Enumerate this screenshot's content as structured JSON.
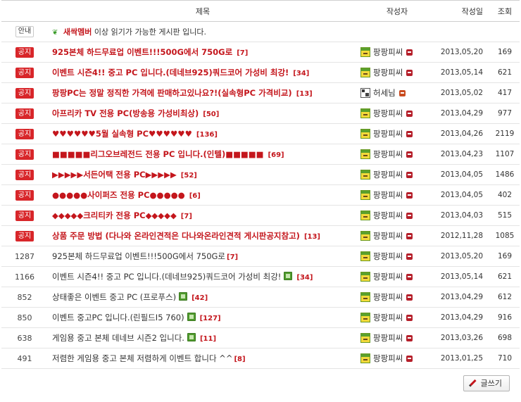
{
  "header": {
    "subject": "제목",
    "author": "작성자",
    "date": "작성일",
    "views": "조회"
  },
  "guide": {
    "badge": "안내",
    "strong": "새싹멤버",
    "rest": " 이상 읽기가 가능한 게시판 입니다."
  },
  "notice_badge": "공지",
  "notices": [
    {
      "title": "925본체 하드무료업 이벤트!!!500G에서 750G로",
      "comments": "[7]",
      "author": "팡팡피씨",
      "avatar": "green",
      "date": "2013,05,20",
      "views": "169"
    },
    {
      "title": "이벤트 시즌4!! 중고 PC 입니다.(데네브925)쿼드코어 가성비 최강!",
      "comments": "[34]",
      "author": "팡팡피씨",
      "avatar": "green",
      "date": "2013,05,14",
      "views": "621"
    },
    {
      "title": "팡팡PC는 정말 정직한 가격에 판매하고있나요?!(실속형PC 가격비교)",
      "comments": "[13]",
      "author": "허세님",
      "avatar": "gray",
      "date": "2013,05,02",
      "views": "417"
    },
    {
      "title": "아프리카 TV 전용 PC(방송용 가성비최상)",
      "comments": "[50]",
      "author": "팡팡피씨",
      "avatar": "green",
      "date": "2013,04,29",
      "views": "977"
    },
    {
      "title": "♥♥♥♥♥♥5월 실속형 PC♥♥♥♥♥♥",
      "comments": "[136]",
      "author": "팡팡피씨",
      "avatar": "green",
      "date": "2013,04,26",
      "views": "2119"
    },
    {
      "title": "■■■■■리그오브레전드 전용 PC 입니다.(인텔)■■■■■",
      "comments": "[69]",
      "author": "팡팡피씨",
      "avatar": "green",
      "date": "2013,04,23",
      "views": "1107"
    },
    {
      "title": "▶▶▶▶▶서든어택 전용 PC▶▶▶▶▶",
      "comments": "[52]",
      "author": "팡팡피씨",
      "avatar": "green",
      "date": "2013,04,05",
      "views": "1486"
    },
    {
      "title": "●●●●●사이퍼즈 전용 PC●●●●●",
      "comments": "[6]",
      "author": "팡팡피씨",
      "avatar": "green",
      "date": "2013,04,05",
      "views": "402"
    },
    {
      "title": "◆◆◆◆◆크리티카 전용 PC◆◆◆◆◆",
      "comments": "[7]",
      "author": "팡팡피씨",
      "avatar": "green",
      "date": "2013,04,03",
      "views": "515"
    },
    {
      "title": "상품 주문 방법 (다나와 온라인견적은 다나와온라인견적 게시판공지참고)",
      "comments": "[13]",
      "author": "팡팡피씨",
      "avatar": "green",
      "date": "2012,11,28",
      "views": "1085"
    }
  ],
  "posts": [
    {
      "num": "1287",
      "title": "925본체 하드무료업 이벤트!!!500G에서 750G로",
      "comments": "[7]",
      "new": false,
      "author": "팡팡피씨",
      "date": "2013,05,20",
      "views": "169"
    },
    {
      "num": "1166",
      "title": "이벤트 시즌4!! 중고 PC 입니다.(데네브925)쿼드코어 가성비 최강!",
      "comments": "[34]",
      "new": true,
      "author": "팡팡피씨",
      "date": "2013,05,14",
      "views": "621"
    },
    {
      "num": "852",
      "title": "상태좋은 이벤트 중고 PC (프로푸스)",
      "comments": "[42]",
      "new": true,
      "author": "팡팡피씨",
      "date": "2013,04,29",
      "views": "612"
    },
    {
      "num": "850",
      "title": "이벤트 중고PC 입니다.(린필드I5 760)",
      "comments": "[127]",
      "new": true,
      "author": "팡팡피씨",
      "date": "2013,04,29",
      "views": "916"
    },
    {
      "num": "638",
      "title": "게임용 중고 본체 데네브 시즌2 입니다.",
      "comments": "[11]",
      "new": true,
      "author": "팡팡피씨",
      "date": "2013,03,26",
      "views": "698"
    },
    {
      "num": "491",
      "title": "저렴한 게임용 중고 본체 저렴하게 이벤트 합니다 ^^",
      "comments": "[8]",
      "new": false,
      "author": "팡팡피씨",
      "date": "2013,01,25",
      "views": "710"
    }
  ],
  "write_button": "글쓰기",
  "colors": {
    "notice_red": "#d8262a",
    "title_red": "#c4161c",
    "border": "#cfcfcf"
  }
}
